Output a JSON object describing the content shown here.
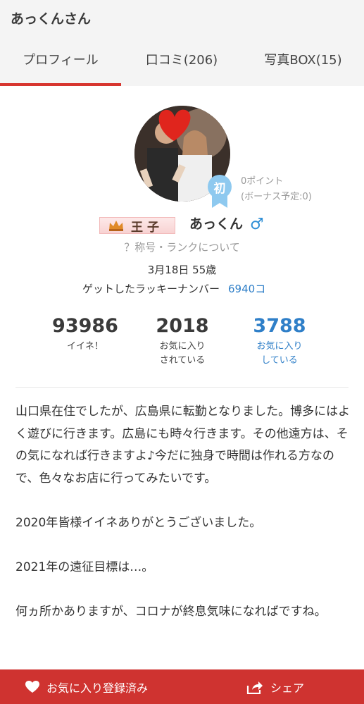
{
  "header": {
    "title": "あっくんさん",
    "tabs": [
      {
        "label": "プロフィール",
        "active": true
      },
      {
        "label": "口コミ(206)",
        "active": false
      },
      {
        "label": "写真BOX(15)",
        "active": false
      }
    ]
  },
  "profile": {
    "avatar_badge": "初",
    "points": "0ポイント",
    "bonus": "(ボーナス予定:0)",
    "rank_title": "王子",
    "nickname": "あっくん",
    "gender_symbol": "♂",
    "rank_help": "？称号・ランクについて",
    "birth": "3月18日 55歳",
    "lucky_label": "ゲットしたラッキーナンバー",
    "lucky_number": "6940コ"
  },
  "stats": [
    {
      "value": "93986",
      "label_line1": "イイネ！",
      "label_line2": ""
    },
    {
      "value": "2018",
      "label_line1": "お気に入り",
      "label_line2": "されている"
    },
    {
      "value": "3788",
      "label_line1": "お気に入り",
      "label_line2": "している"
    }
  ],
  "bio": [
    "山口県在住でしたが、広島県に転勤となりました。博多にはよく遊びに行きます。広島にも時々行きます。その他遠方は、その気になれば行きますよ♪今だに独身で時間は作れる方なので、色々なお店に行ってみたいです。",
    "2020年皆様イイネありがとうございました。",
    "2021年の遠征目標は…。",
    "何ヵ所かありますが、コロナが終息気味になればですね。"
  ],
  "bottom_bar": {
    "favorite_label": "お気に入り登録済み",
    "share_label": "シェア"
  },
  "colors": {
    "accent_red": "#d7352f",
    "link_blue": "#2f7fc8",
    "gender_blue": "#2f8fd6"
  },
  "icons": [
    "heart-icon",
    "share-icon",
    "crown-icon",
    "male-icon",
    "ribbon-badge-icon"
  ]
}
